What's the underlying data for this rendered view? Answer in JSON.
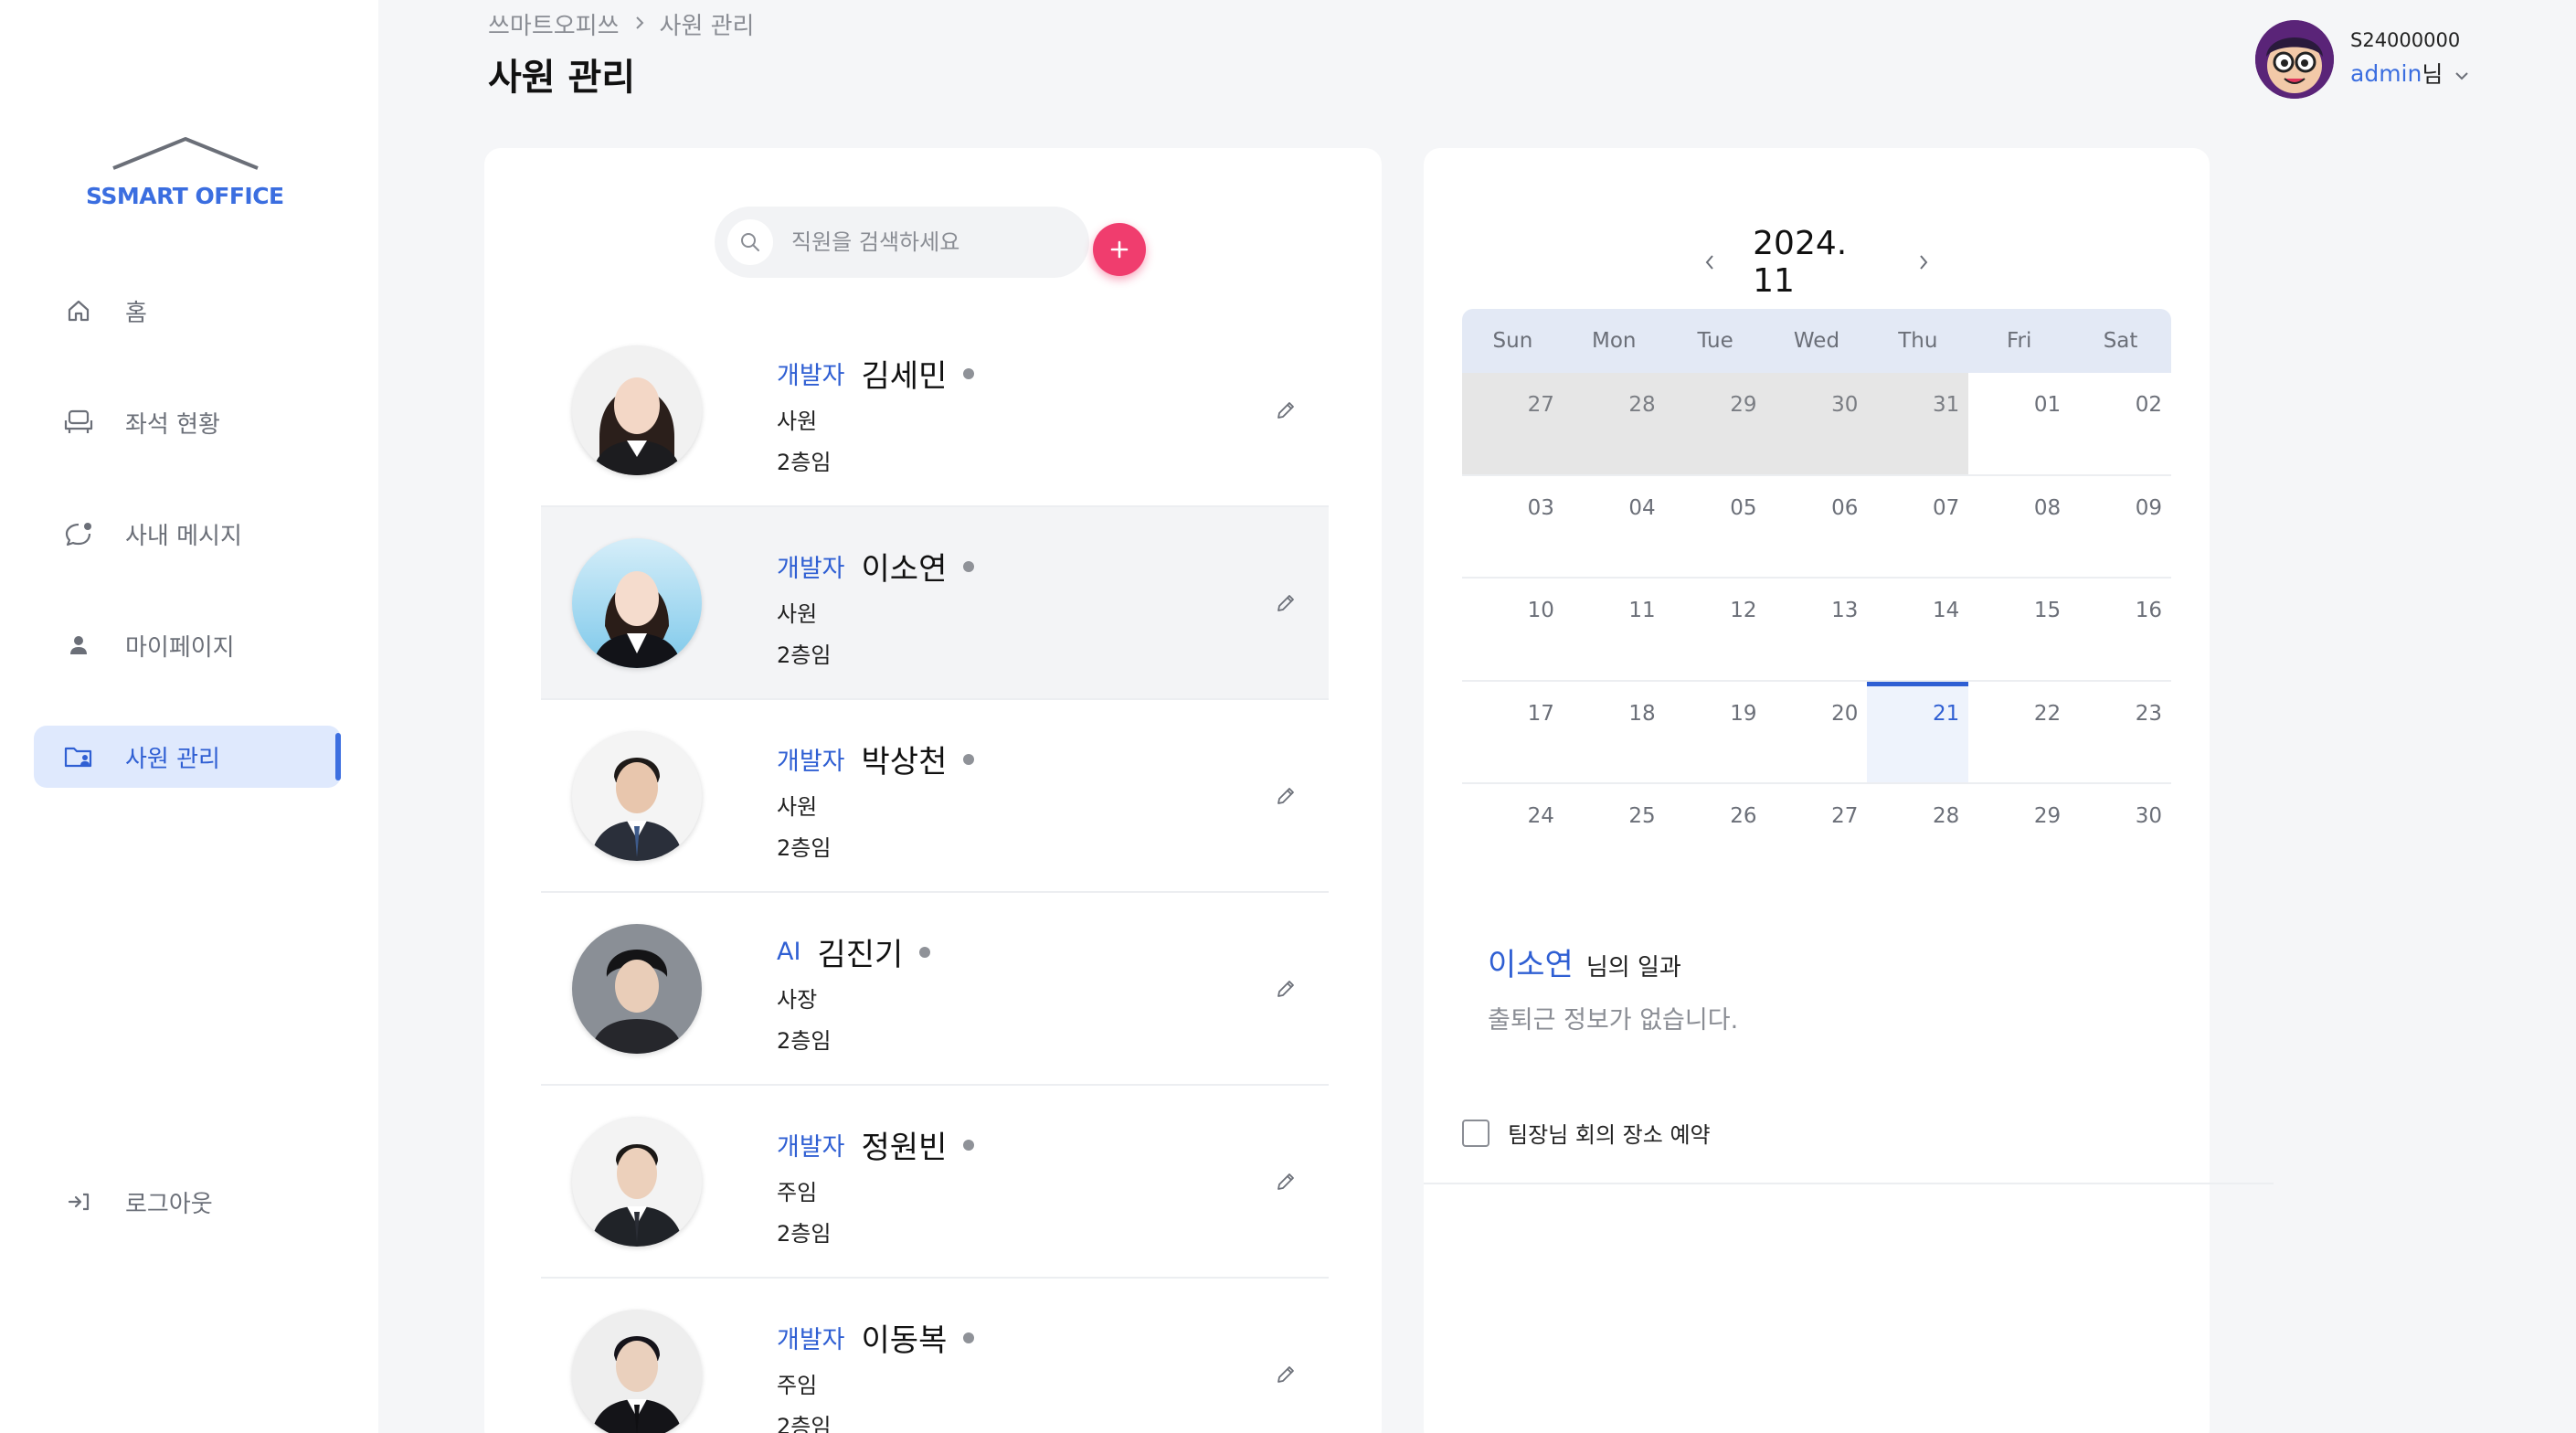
{
  "sidebar": {
    "logo_text": "SSMART OFFICE",
    "items": [
      {
        "label": "홈",
        "icon": "home-icon"
      },
      {
        "label": "좌석 현황",
        "icon": "seat-icon"
      },
      {
        "label": "사내 메시지",
        "icon": "message-icon"
      },
      {
        "label": "마이페이지",
        "icon": "person-icon"
      },
      {
        "label": "사원 관리",
        "icon": "folder-user-icon",
        "active": true
      }
    ],
    "logout_label": "로그아웃"
  },
  "header": {
    "breadcrumb": [
      "쓰마트오피쓰",
      "사원 관리"
    ],
    "title": "사원 관리"
  },
  "user": {
    "id": "S24000000",
    "name": "admin",
    "honorific": "님"
  },
  "search": {
    "placeholder": "직원을 검색하세요",
    "value": ""
  },
  "employees": [
    {
      "dept": "개발자",
      "name": "김세민",
      "rank": "사원",
      "floor": "2층임"
    },
    {
      "dept": "개발자",
      "name": "이소연",
      "rank": "사원",
      "floor": "2층임",
      "selected": true
    },
    {
      "dept": "개발자",
      "name": "박상천",
      "rank": "사원",
      "floor": "2층임"
    },
    {
      "dept": "AI",
      "name": "김진기",
      "rank": "사장",
      "floor": "2층임"
    },
    {
      "dept": "개발자",
      "name": "정원빈",
      "rank": "주임",
      "floor": "2층임"
    },
    {
      "dept": "개발자",
      "name": "이동복",
      "rank": "주임",
      "floor": "2층임"
    }
  ],
  "calendar": {
    "month_label": "2024. 11",
    "weekdays": [
      "Sun",
      "Mon",
      "Tue",
      "Wed",
      "Thu",
      "Fri",
      "Sat"
    ],
    "weeks": [
      [
        "27",
        "28",
        "29",
        "30",
        "31",
        "01",
        "02"
      ],
      [
        "03",
        "04",
        "05",
        "06",
        "07",
        "08",
        "09"
      ],
      [
        "10",
        "11",
        "12",
        "13",
        "14",
        "15",
        "16"
      ],
      [
        "17",
        "18",
        "19",
        "20",
        "21",
        "22",
        "23"
      ],
      [
        "24",
        "25",
        "26",
        "27",
        "28",
        "29",
        "30"
      ]
    ],
    "selected_day": "21"
  },
  "work": {
    "name": "이소연",
    "suffix": "님의 일과",
    "empty_text": "출퇴근 정보가 없습니다.",
    "todo_label": "팀장님 회의 장소 예약",
    "todo_checked": false
  },
  "colors": {
    "accent": "#2f5fd3",
    "add_button": "#f03d6e",
    "active_nav_bg": "#dfe9fd"
  }
}
